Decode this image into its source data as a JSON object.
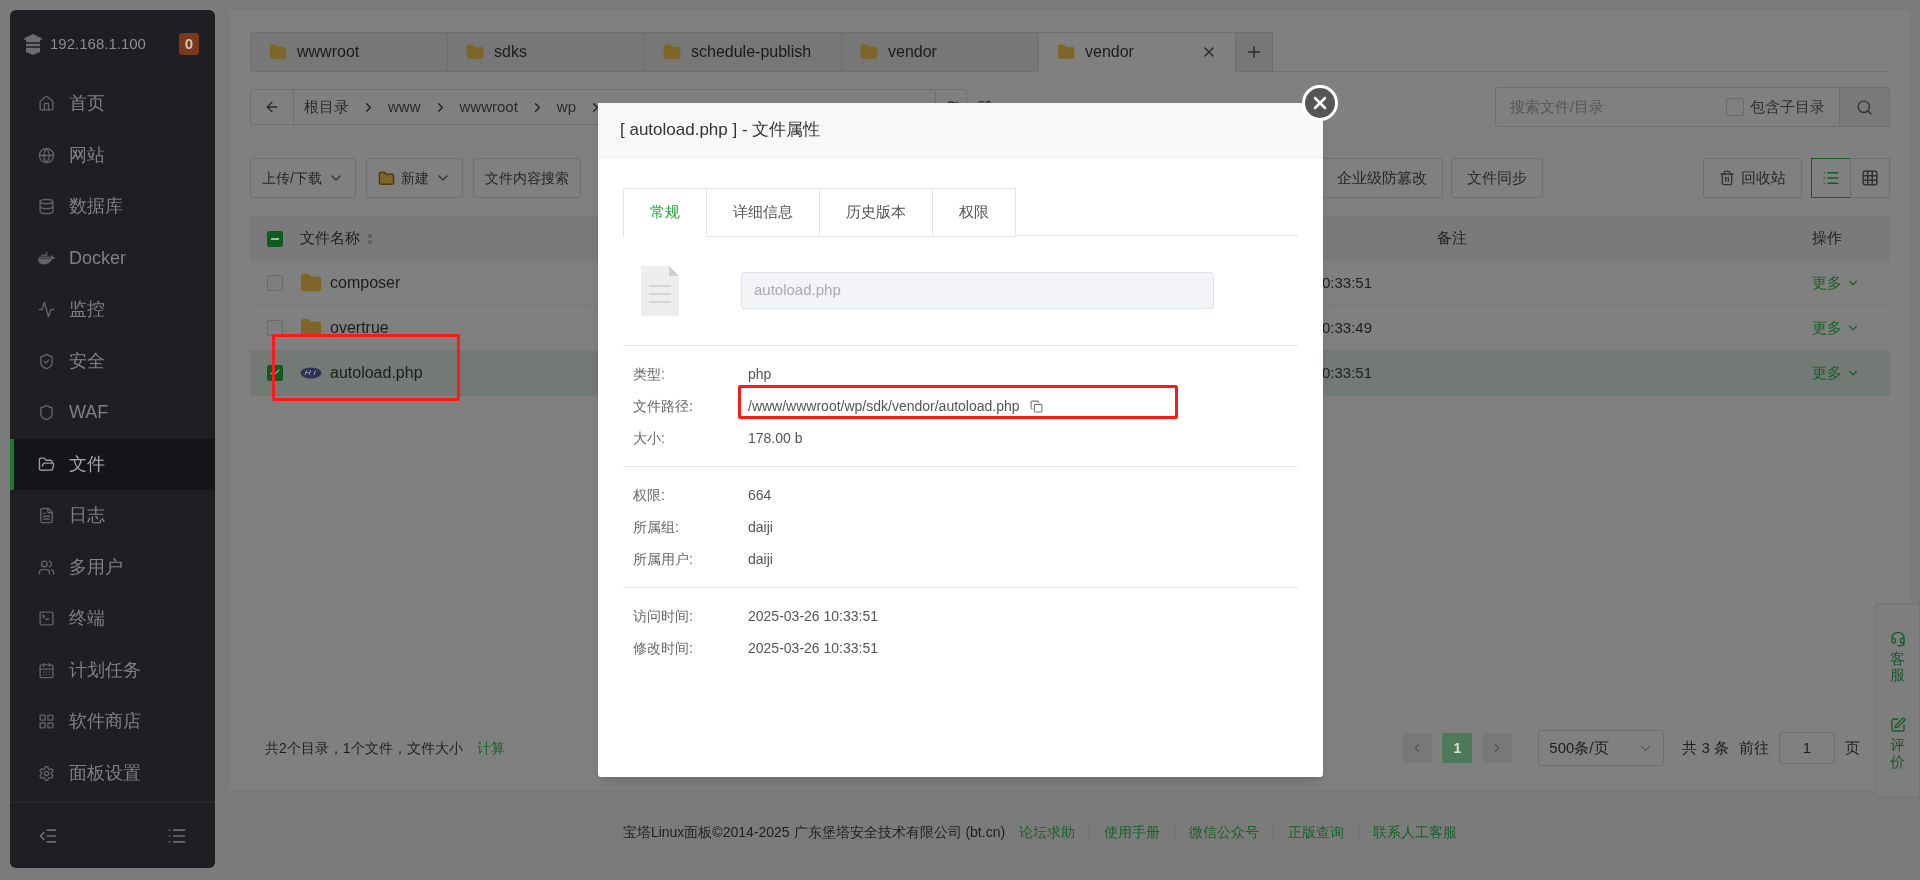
{
  "sidebar": {
    "host": "192.168.1.100",
    "badge": "0",
    "items": [
      {
        "label": "首页",
        "selected": false
      },
      {
        "label": "网站",
        "selected": false
      },
      {
        "label": "数据库",
        "selected": false
      },
      {
        "label": "Docker",
        "selected": false
      },
      {
        "label": "监控",
        "selected": false
      },
      {
        "label": "安全",
        "selected": false
      },
      {
        "label": "WAF",
        "selected": false
      },
      {
        "label": "文件",
        "selected": true
      },
      {
        "label": "日志",
        "selected": false
      },
      {
        "label": "多用户",
        "selected": false
      },
      {
        "label": "终端",
        "selected": false
      },
      {
        "label": "计划任务",
        "selected": false
      },
      {
        "label": "软件商店",
        "selected": false
      },
      {
        "label": "面板设置",
        "selected": false
      }
    ]
  },
  "file_tabs": [
    {
      "label": "wwwroot",
      "selected": false
    },
    {
      "label": "sdks",
      "selected": false
    },
    {
      "label": "schedule-publish",
      "selected": false
    },
    {
      "label": "vendor",
      "selected": false
    },
    {
      "label": "vendor",
      "selected": true
    }
  ],
  "breadcrumb": {
    "parts": [
      "根目录",
      "www",
      "wwwroot",
      "wp"
    ]
  },
  "search": {
    "placeholder": "搜索文件/目录",
    "include_sub_label": "包含子目录",
    "include_sub_checked": false
  },
  "toolbar": {
    "left": [
      {
        "label": "上传/下载",
        "kind": "dropdown"
      },
      {
        "label": "新建",
        "kind": "new"
      },
      {
        "label": "文件内容搜索",
        "kind": "plain"
      }
    ],
    "right": [
      "企业级防篡改",
      "文件同步"
    ],
    "recycle": "回收站",
    "view_modes": [
      {
        "kind": "list",
        "selected": true
      },
      {
        "kind": "grid",
        "selected": false
      }
    ]
  },
  "table": {
    "select_all_indeterminate": true,
    "columns": [
      "文件名称",
      "备注",
      "操作"
    ],
    "rows": [
      {
        "name": "composer",
        "kind": "folder",
        "checked": false,
        "time": "0:33:51",
        "action": "更多"
      },
      {
        "name": "overtrue",
        "kind": "folder",
        "checked": false,
        "time": "0:33:49",
        "action": "更多"
      },
      {
        "name": "autoload.php",
        "kind": "file",
        "checked": true,
        "time": "0:33:51",
        "action": "更多"
      }
    ]
  },
  "summary": {
    "text": "共2个目录，1个文件，文件大小",
    "link": "计算"
  },
  "pagination": {
    "pages": [
      {
        "label": "1",
        "selected": true
      }
    ],
    "page_size": "500条/页",
    "total": "共 3 条",
    "goto": "前往",
    "page_input": "1",
    "page_unit": "页"
  },
  "footer": {
    "copyright": "宝塔Linux面板©2014-2025 广东堡塔安全技术有限公司 (bt.cn)",
    "links": [
      "论坛求助",
      "使用手册",
      "微信公众号",
      "正版查询",
      "联系人工客服"
    ]
  },
  "float_buttons": [
    {
      "label": "客服",
      "kind": "support"
    },
    {
      "label": "评价",
      "kind": "review"
    }
  ],
  "modal": {
    "title": "[ autoload.php ] - 文件属性",
    "tabs": [
      {
        "label": "常规",
        "selected": true
      },
      {
        "label": "详细信息",
        "selected": false
      },
      {
        "label": "历史版本",
        "selected": false
      },
      {
        "label": "权限",
        "selected": false
      }
    ],
    "name_field": {
      "value": "autoload.php",
      "disabled": true
    },
    "groups": [
      [
        {
          "label": "类型:",
          "value": "php"
        },
        {
          "label": "文件路径:",
          "value": "/www/wwwroot/wp/sdk/vendor/autoload.php",
          "copyable": true
        },
        {
          "label": "大小:",
          "value": "178.00 b"
        }
      ],
      [
        {
          "label": "权限:",
          "value": "664"
        },
        {
          "label": "所属组:",
          "value": "daiji"
        },
        {
          "label": "所属用户:",
          "value": "daiji"
        }
      ],
      [
        {
          "label": "访问时间:",
          "value": "2025-03-26 10:33:51"
        },
        {
          "label": "修改时间:",
          "value": "2025-03-26 10:33:51"
        }
      ]
    ]
  }
}
